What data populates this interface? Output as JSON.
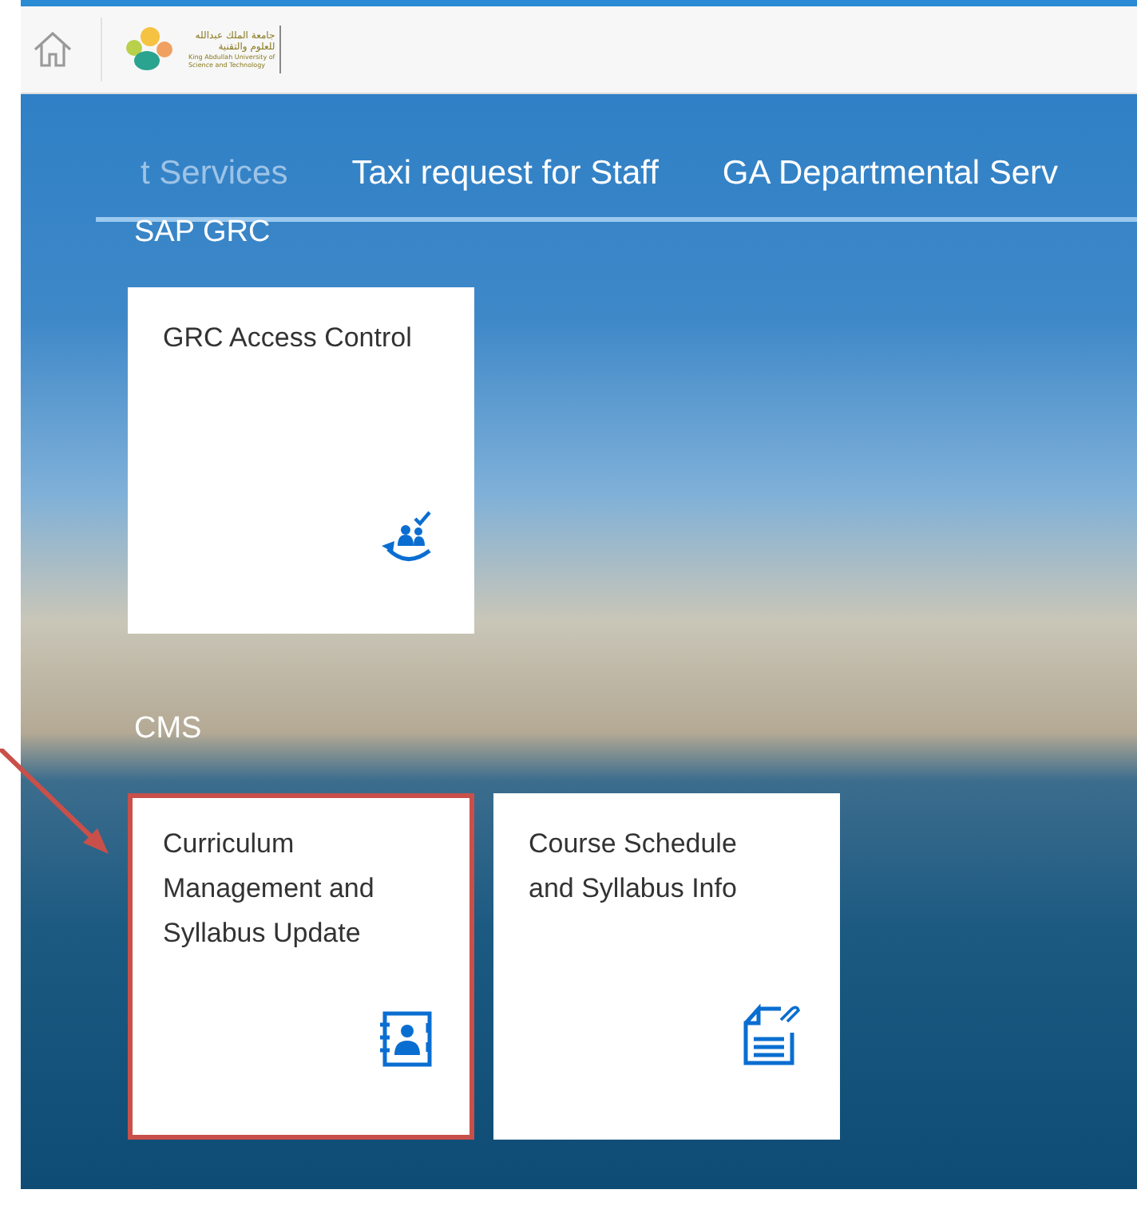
{
  "header": {
    "logo": {
      "arabic_lines": [
        "جامعة الملك عبدالله",
        "للعلوم والتقنية"
      ],
      "english_lines": [
        "King Abdullah University of",
        "Science and Technology"
      ]
    }
  },
  "tabs": [
    {
      "label": "t Services",
      "faded": true
    },
    {
      "label": "Taxi request for Staff",
      "faded": false
    },
    {
      "label": "GA Departmental Serv",
      "faded": false
    }
  ],
  "groups": [
    {
      "title": "SAP GRC",
      "tiles": [
        {
          "title": "GRC Access Control",
          "kind": "access",
          "highlighted": false
        }
      ]
    },
    {
      "title": "CMS",
      "tiles": [
        {
          "title": "Curriculum Management and Syllabus Update",
          "kind": "contacts",
          "highlighted": true
        },
        {
          "title": "Course Schedule and Syllabus Info",
          "kind": "document",
          "highlighted": false
        }
      ]
    }
  ],
  "annotation": {
    "arrow": true
  }
}
